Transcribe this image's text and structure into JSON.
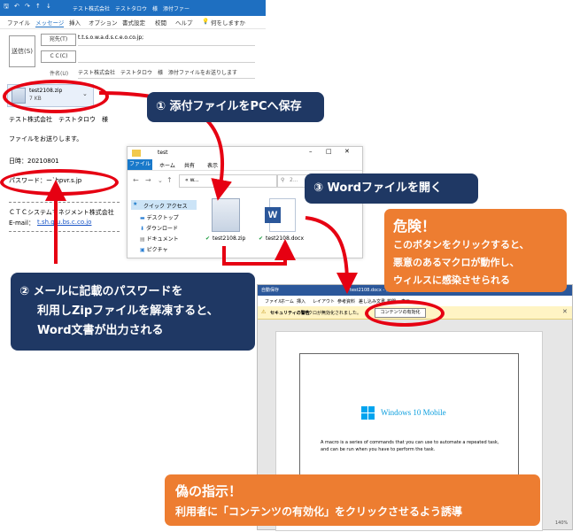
{
  "outlook": {
    "title": "テスト株式会社　テストタロウ　様　添付ファー",
    "menu": [
      "ファイル",
      "メッセージ",
      "挿入",
      "オプション",
      "書式設定",
      "校閲",
      "ヘルプ",
      "何をしますか"
    ],
    "send_label": "送信(S)",
    "to_label": "宛先(T)",
    "to_value": "t.t.s.o.w.a.d.s.c.e.o.co.jp;",
    "cc_label": "ＣＣ(C)",
    "subject_label": "件名(U)",
    "subject_value": "テスト株式会社　テストタロウ　様　添付ファイルをお送りします",
    "attachment_name": "test2108.zip",
    "attachment_size": "7 KB",
    "body": {
      "line1": "テスト株式会社　テストタロウ　様",
      "line2": "ファイルをお送りします。",
      "line3": "日時：20210801",
      "line4": "パスワード：ー`hpvr.s.jp",
      "company": "ＣＴＣシステムマネジメント株式会社",
      "email_label": "E-mail：",
      "email_value": "t.sh.g.u.bs.c.co.jo"
    }
  },
  "explorer": {
    "title": "test",
    "tabs": [
      "ファイル",
      "ホーム",
      "共有",
      "表示"
    ],
    "address": "«  w...",
    "search_placeholder": "2...",
    "nav": [
      "クイック アクセス",
      "デスクトップ",
      "ダウンロード",
      "ドキュメント",
      "ピクチャ"
    ],
    "files": [
      {
        "name": "test2108.zip"
      },
      {
        "name": "test2108.docx"
      }
    ]
  },
  "word": {
    "title": "test2108.docx - 保存済み",
    "autosave": "自動保存",
    "tabs": [
      "ファイル",
      "ホーム",
      "挿入",
      "レイアウト",
      "参考資料",
      "差し込み文書",
      "校閲",
      "表示"
    ],
    "warning_label": "セキュリティの警告",
    "warning_text": "マクロが無効化されました。",
    "enable_button": "コンテンツの有効化",
    "doc_title": "Windows 10 Mobile",
    "doc_text1": "A macro is a series of commands that you can use to automate a repeated task,",
    "doc_text2": "and can be run when you have to perform the task.",
    "zoom": "140%"
  },
  "callouts": {
    "step1": "①  添付ファイルをPCへ保存",
    "step2_l1": "②  メールに記載のパスワードを",
    "step2_l2": "利用しZipファイルを解凍すると、",
    "step2_l3": "Word文書が出力される",
    "step3": "③  Wordファイルを開く",
    "danger_title": "危険！",
    "danger_l1": "このボタンをクリックすると、",
    "danger_l2": "悪意のあるマクロが動作し、",
    "danger_l3": "ウィルスに感染させられる",
    "fake_title": "偽の指示！",
    "fake_text": "利用者に「コンテンツの有効化」をクリックさせるよう誘導"
  },
  "colors": {
    "navy": "#1f3864",
    "orange": "#ed7d31",
    "red": "#e60012",
    "outlook_blue": "#1e6fc1",
    "word_blue": "#2b579a"
  }
}
